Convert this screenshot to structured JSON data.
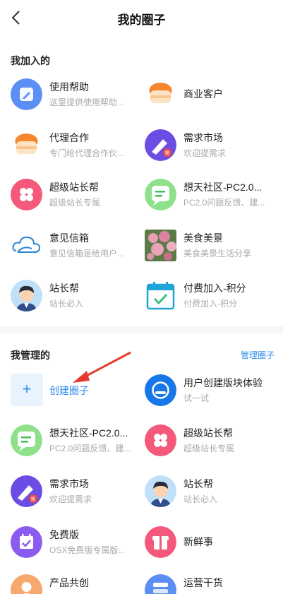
{
  "header": {
    "title": "我的圈子"
  },
  "joined": {
    "title": "我加入的",
    "items": [
      {
        "name": "使用帮助",
        "desc": "这里提供使用帮助..."
      },
      {
        "name": "商业客户",
        "desc": ""
      },
      {
        "name": "代理合作",
        "desc": "专门给代理合作伙..."
      },
      {
        "name": "需求市场",
        "desc": "欢迎提需求"
      },
      {
        "name": "超级站长帮",
        "desc": "超级站长专属"
      },
      {
        "name": "想天社区-PC2.0...",
        "desc": "PC2.0问题反馈、建..."
      },
      {
        "name": "意见信箱",
        "desc": "意见信箱是给用户..."
      },
      {
        "name": "美食美景",
        "desc": "美食美景生活分享"
      },
      {
        "name": "站长帮",
        "desc": "站长必入"
      },
      {
        "name": "付费加入-积分",
        "desc": "付费加入-积分"
      }
    ]
  },
  "managed": {
    "title": "我管理的",
    "manage_link": "管理圈子",
    "create_symbol": "+",
    "create_label": "创建圈子",
    "items": [
      {
        "name": "用户创建版块体验",
        "desc": "试一试"
      },
      {
        "name": "想天社区-PC2.0...",
        "desc": "PC2.0问题反馈、建..."
      },
      {
        "name": "超级站长帮",
        "desc": "超级站长专属"
      },
      {
        "name": "需求市场",
        "desc": "欢迎提需求"
      },
      {
        "name": "站长帮",
        "desc": "站长必入"
      },
      {
        "name": "免费版",
        "desc": "OSX免费版专属版..."
      },
      {
        "name": "新鲜事",
        "desc": ""
      },
      {
        "name": "产品共创",
        "desc": ""
      },
      {
        "name": "运营干货",
        "desc": ""
      }
    ]
  },
  "icons": [
    "back-icon",
    "pencil-note-icon",
    "cake-icon",
    "marker-icon",
    "clover-icon",
    "chat-icon",
    "cloud-icon",
    "flowers-photo",
    "man-avatar-icon",
    "calendar-check-icon",
    "robot-icon",
    "gift-icon",
    "notebook-icon",
    "person-icon",
    "stack-icon"
  ],
  "colors": {
    "accent": "#2d8cf0",
    "arrow": "#e63a2e"
  }
}
